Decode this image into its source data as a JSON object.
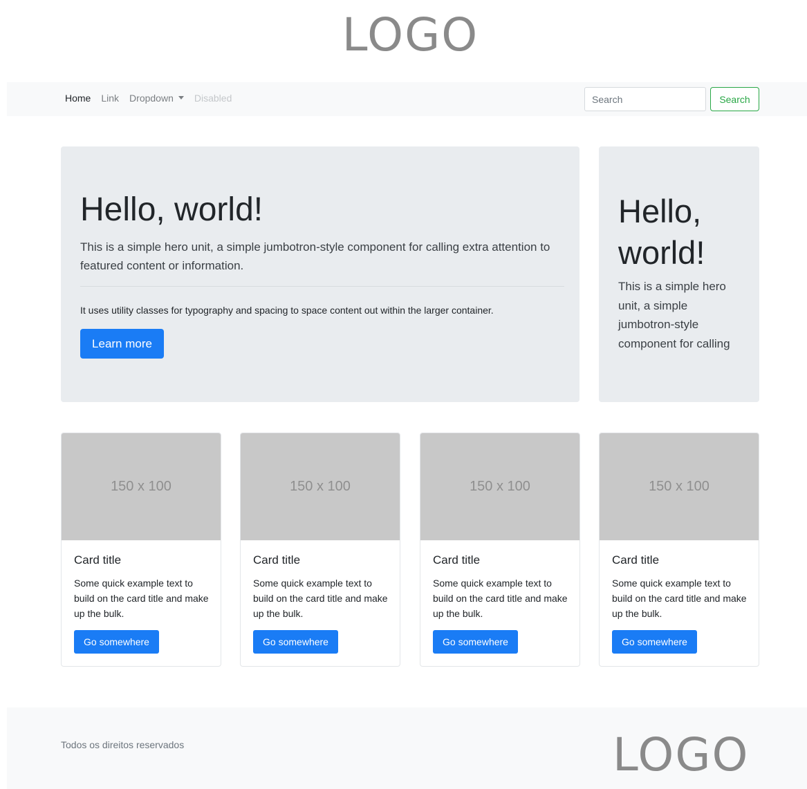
{
  "header": {
    "logo": "LOGO"
  },
  "navbar": {
    "links": [
      {
        "label": "Home",
        "state": "active"
      },
      {
        "label": "Link",
        "state": "normal"
      },
      {
        "label": "Dropdown",
        "state": "normal"
      },
      {
        "label": "Disabled",
        "state": "disabled"
      }
    ],
    "search": {
      "placeholder": "Search",
      "button_label": "Search"
    }
  },
  "jumbotron_main": {
    "title": "Hello, world!",
    "lead": "This is a simple hero unit, a simple jumbotron-style component for calling extra attention to featured content or information.",
    "body": "It uses utility classes for typography and spacing to space content out within the larger container.",
    "button_label": "Learn more"
  },
  "jumbotron_side": {
    "title": "Hello, world!",
    "lead": "This is a simple hero unit, a simple jumbotron-style component for calling"
  },
  "cards": [
    {
      "image_label": "150 x 100",
      "title": "Card title",
      "text": "Some quick example text to build on the card title and make up the bulk.",
      "button_label": "Go somewhere"
    },
    {
      "image_label": "150 x 100",
      "title": "Card title",
      "text": "Some quick example text to build on the card title and make up the bulk.",
      "button_label": "Go somewhere"
    },
    {
      "image_label": "150 x 100",
      "title": "Card title",
      "text": "Some quick example text to build on the card title and make up the bulk.",
      "button_label": "Go somewhere"
    },
    {
      "image_label": "150 x 100",
      "title": "Card title",
      "text": "Some quick example text to build on the card title and make up the bulk.",
      "button_label": "Go somewhere"
    }
  ],
  "footer": {
    "text": "Todos os direitos reservados",
    "logo": "LOGO"
  },
  "colors": {
    "primary": "#1a7cf5",
    "success": "#28a745",
    "jumbotron_bg": "#e9ecef",
    "navbar_bg": "#f8f9fa"
  }
}
